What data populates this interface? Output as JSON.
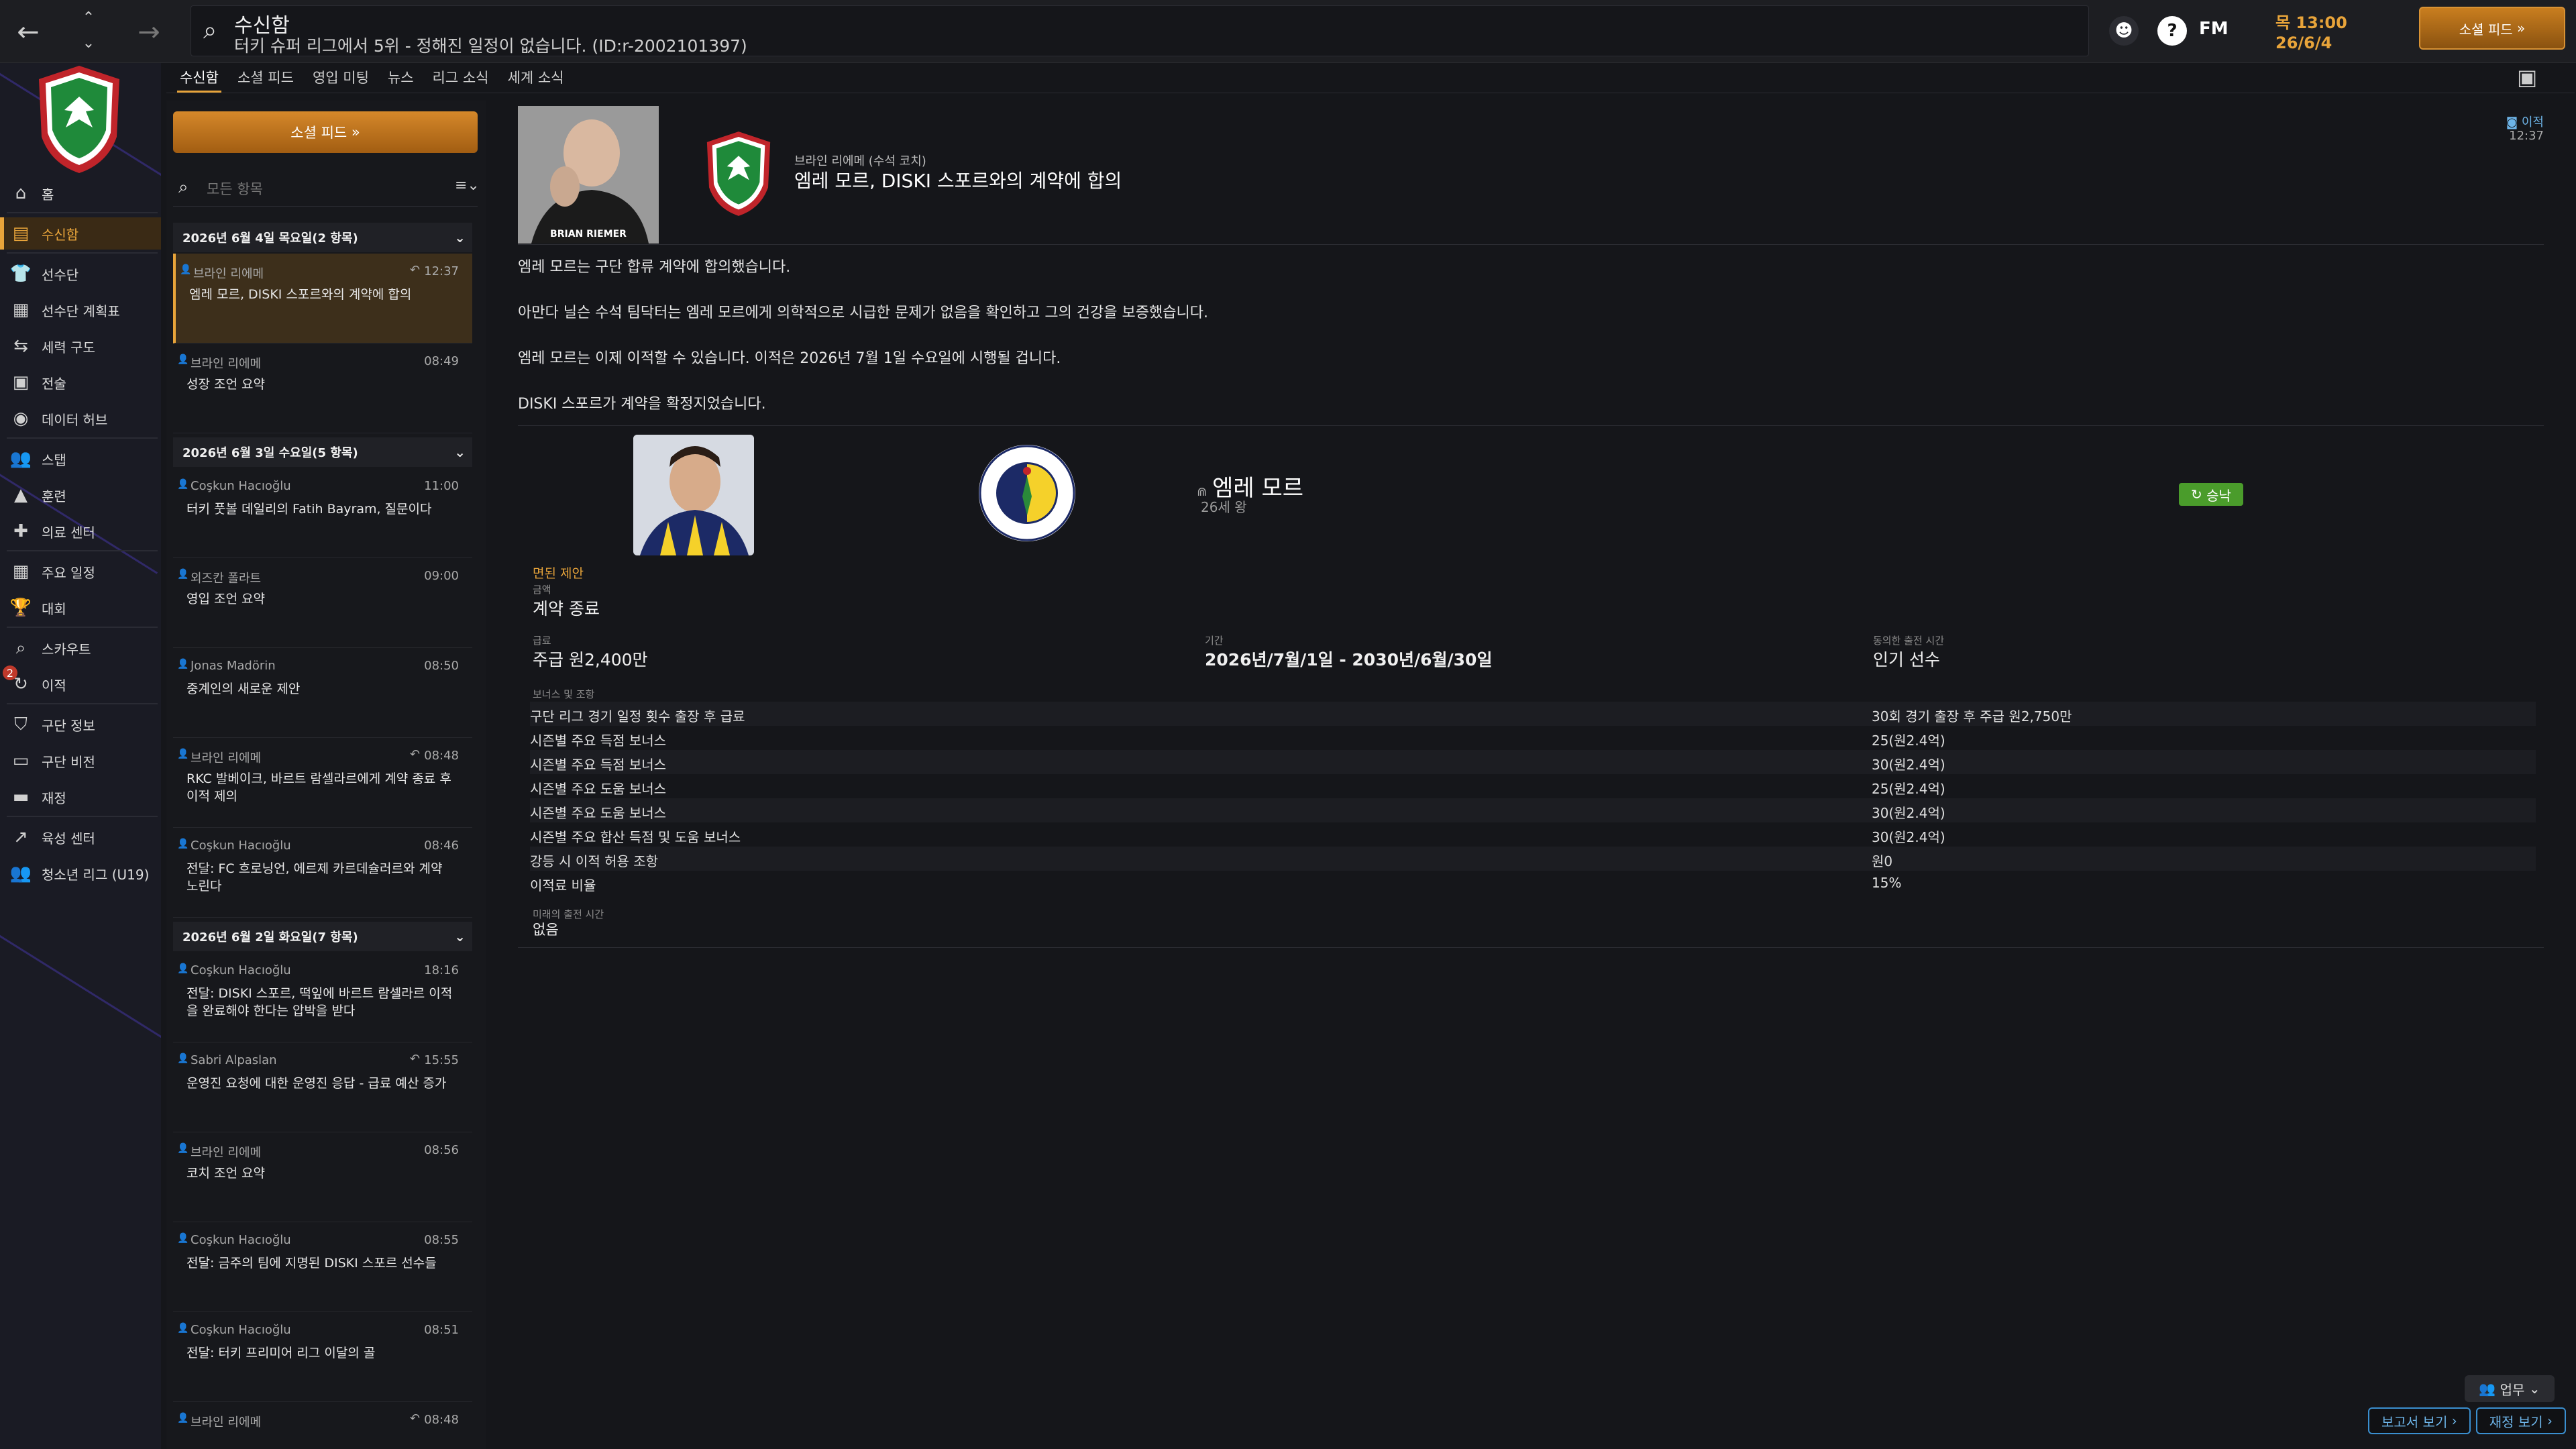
{
  "topbar": {
    "title": "수신함",
    "subtitle": "터키 슈퍼 리그에서 5위 - 정해진 일정이 없습니다. (ID:r-2002101397)",
    "fm_label": "FM",
    "date_line1": "목 13:00",
    "date_line2": "26/6/4",
    "social_label": "소셜 피드"
  },
  "sidebar": {
    "items": [
      {
        "label": "홈",
        "icon": "home-icon"
      },
      {
        "label": "수신함",
        "icon": "inbox-icon",
        "active": true
      },
      {
        "label": "선수단",
        "icon": "shirt-icon"
      },
      {
        "label": "선수단 계획표",
        "icon": "clipboard-icon"
      },
      {
        "label": "세력 구도",
        "icon": "dynamics-icon"
      },
      {
        "label": "전술",
        "icon": "tactics-icon"
      },
      {
        "label": "데이터 허브",
        "icon": "data-icon"
      },
      {
        "label": "스탭",
        "icon": "staff-icon"
      },
      {
        "label": "훈련",
        "icon": "training-icon"
      },
      {
        "label": "의료 센터",
        "icon": "medical-icon"
      },
      {
        "label": "주요 일정",
        "icon": "calendar-icon"
      },
      {
        "label": "대회",
        "icon": "trophy-icon"
      },
      {
        "label": "스카우트",
        "icon": "scout-icon"
      },
      {
        "label": "이적",
        "icon": "transfer-icon",
        "badge": "2"
      },
      {
        "label": "구단 정보",
        "icon": "club-icon"
      },
      {
        "label": "구단 비전",
        "icon": "vision-icon"
      },
      {
        "label": "재정",
        "icon": "finance-icon"
      },
      {
        "label": "육성 센터",
        "icon": "development-icon"
      },
      {
        "label": "청소년 리그 (U19)",
        "icon": "youth-icon"
      }
    ]
  },
  "tabs": [
    "수신함",
    "소셜 피드",
    "영입 미팅",
    "뉴스",
    "리그 소식",
    "세계 소식"
  ],
  "list": {
    "social_button": "소셜 피드",
    "filter_placeholder": "모든 항목",
    "groups": [
      {
        "label": "2026년 6월 4일 목요일(2 항목)"
      },
      {
        "label": "2026년 6월 3일 수요일(5 항목)"
      },
      {
        "label": "2026년 6월 2일 화요일(7 항목)"
      }
    ],
    "messages": [
      {
        "sender": "브라인 리에메",
        "time": "12:37",
        "subject": "엠레 모르, DISKI 스포르와의 계약에 합의",
        "active": true,
        "reply": true
      },
      {
        "sender": "브라인 리에메",
        "time": "08:49",
        "subject": "성장 조언 요약"
      },
      {
        "sender": "Coşkun Hacıoğlu",
        "time": "11:00",
        "subject": "터키 풋볼 데일리의 Fatih Bayram, 질문이다"
      },
      {
        "sender": "외즈칸 폴라트",
        "time": "09:00",
        "subject": "영입 조언 요약"
      },
      {
        "sender": "Jonas Madörin",
        "time": "08:50",
        "subject": "중계인의 새로운 제안"
      },
      {
        "sender": "브라인 리에메",
        "time": "08:48",
        "subject": "RKC 발베이크, 바르트 람셀라르에게 계약 종료 후 이적 제의",
        "reply": true
      },
      {
        "sender": "Coşkun Hacıoğlu",
        "time": "08:46",
        "subject": "전달: FC 흐로닝언, 에르제 카르데슐러르와 계약 노린다"
      },
      {
        "sender": "Coşkun Hacıoğlu",
        "time": "18:16",
        "subject": "전달: DISKI 스포르, 떡잎에 바르트 람셀라르 이적을 완료해야 한다는 압박을 받다"
      },
      {
        "sender": "Sabri Alpaslan",
        "time": "15:55",
        "subject": "운영진 요청에 대한 운영진 응답 - 급료 예산 증가",
        "reply": true
      },
      {
        "sender": "브라인 리에메",
        "time": "08:56",
        "subject": "코치 조언 요약"
      },
      {
        "sender": "Coşkun Hacıoğlu",
        "time": "08:55",
        "subject": "전달: 금주의 팀에 지명된 DISKI 스포르 선수들"
      },
      {
        "sender": "Coşkun Hacıoğlu",
        "time": "08:51",
        "subject": "전달: 터키 프리미어 리그 이달의 골"
      },
      {
        "sender": "브라인 리에메",
        "time": "08:48",
        "subject": "",
        "reply": true
      }
    ]
  },
  "message": {
    "coach_caption": "BRIAN RIEMER",
    "from": "브라인 리에메 (수석 코치)",
    "title": "엠레 모르, DISKI 스포르와의 계약에 합의",
    "tag": "이적",
    "time": "12:37",
    "paragraphs": [
      "엠레 모르는 구단 합류 계약에 합의했습니다.",
      "아만다 닐슨 수석 팀닥터는 엠레 모르에게 의학적으로 시급한 문제가 없음을 확인하고 그의 건강을 보증했습니다.",
      "엠레 모르는 이제 이적할 수 있습니다. 이적은 2026년 7월 1일 수요일에 시행될 겁니다.",
      "DISKI 스포르가 계약을 확정지었습니다."
    ],
    "player_name": "엠레 모르",
    "player_age": "26세 왕",
    "status": "승낙",
    "fee_label": "면된 제안",
    "fee_sublabel": "금액",
    "fee_value": "계약 종료",
    "wage_label": "급료",
    "wage_value": "주급 원2,400만",
    "period_label": "기간",
    "period_value": "2026년/7월/1일 - 2030년/6월/30일",
    "playing_time_label": "동의한 출전 시간",
    "playing_time_value": "인기 선수",
    "bonus_label": "보너스 및 조항",
    "bonuses": [
      {
        "k": "구단 리그 경기 일정 횟수 출장 후 급료",
        "v": "30회 경기 출장 후 주급 원2,750만"
      },
      {
        "k": "시즌별 주요 득점 보너스",
        "v": "25(원2.4억)"
      },
      {
        "k": "시즌별 주요 득점 보너스",
        "v": "30(원2.4억)"
      },
      {
        "k": "시즌별 주요 도움 보너스",
        "v": "25(원2.4억)"
      },
      {
        "k": "시즌별 주요 도움 보너스",
        "v": "30(원2.4억)"
      },
      {
        "k": "시즌별 주요 합산 득점 및 도움 보너스",
        "v": "30(원2.4억)"
      },
      {
        "k": "강등 시 이적 허용 조항",
        "v": "원0"
      },
      {
        "k": "이적료 비율",
        "v": "15%"
      }
    ],
    "future_label": "미래의 출전 시간",
    "future_value": "없음"
  },
  "footer": {
    "business_label": "업무",
    "report_label": "보고서 보기",
    "finance_label": "재정 보기"
  },
  "colors": {
    "accent": "#e8a43a",
    "accept": "#4a9c2b",
    "link": "#6db4e8"
  }
}
